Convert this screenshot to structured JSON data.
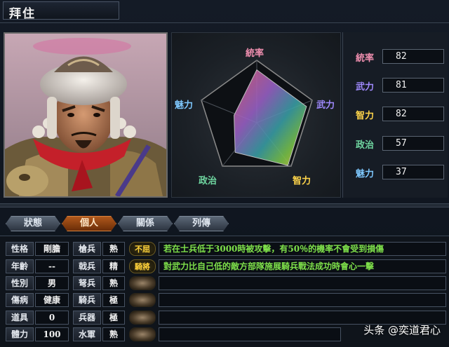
{
  "general": {
    "name": "拜住"
  },
  "radar": {
    "labels": [
      "統率",
      "武力",
      "智力",
      "政治",
      "魅力"
    ],
    "label_colors": [
      "#f08fb0",
      "#a08aff",
      "#ffd54a",
      "#6fd6a0",
      "#7ec8ff"
    ]
  },
  "stats": [
    {
      "label": "統率",
      "value": "82",
      "color": "#f08fb0"
    },
    {
      "label": "武力",
      "value": "81",
      "color": "#a08aff"
    },
    {
      "label": "智力",
      "value": "82",
      "color": "#ffd54a"
    },
    {
      "label": "政治",
      "value": "57",
      "color": "#6fd6a0"
    },
    {
      "label": "魅力",
      "value": "37",
      "color": "#7ec8ff"
    }
  ],
  "tabs": [
    "狀態",
    "個人",
    "關係",
    "列傳"
  ],
  "active_tab": "個人",
  "personal": [
    {
      "label": "性格",
      "value": "剛膽"
    },
    {
      "label": "年齡",
      "value": "--"
    },
    {
      "label": "性別",
      "value": "男"
    },
    {
      "label": "傷病",
      "value": "健康"
    },
    {
      "label": "道具",
      "value": "0"
    },
    {
      "label": "體力",
      "value": "100"
    }
  ],
  "aptitudes": [
    {
      "label": "槍兵",
      "value": "熟"
    },
    {
      "label": "戟兵",
      "value": "精"
    },
    {
      "label": "弩兵",
      "value": "熟"
    },
    {
      "label": "騎兵",
      "value": "極"
    },
    {
      "label": "兵器",
      "value": "極"
    },
    {
      "label": "水軍",
      "value": "熟"
    }
  ],
  "skills": [
    {
      "tag": "不屈",
      "desc": "若在士兵低于3000時被攻擊，有50％的機率不會受到損傷"
    },
    {
      "tag": "騎將",
      "desc": "對武力比自己低的敵方部隊施展騎兵戰法成功時會心一擊"
    },
    {
      "tag": "",
      "desc": ""
    },
    {
      "tag": "",
      "desc": ""
    },
    {
      "tag": "",
      "desc": ""
    },
    {
      "tag": "",
      "desc": ""
    }
  ],
  "watermark": "头条 @奕道君心"
}
